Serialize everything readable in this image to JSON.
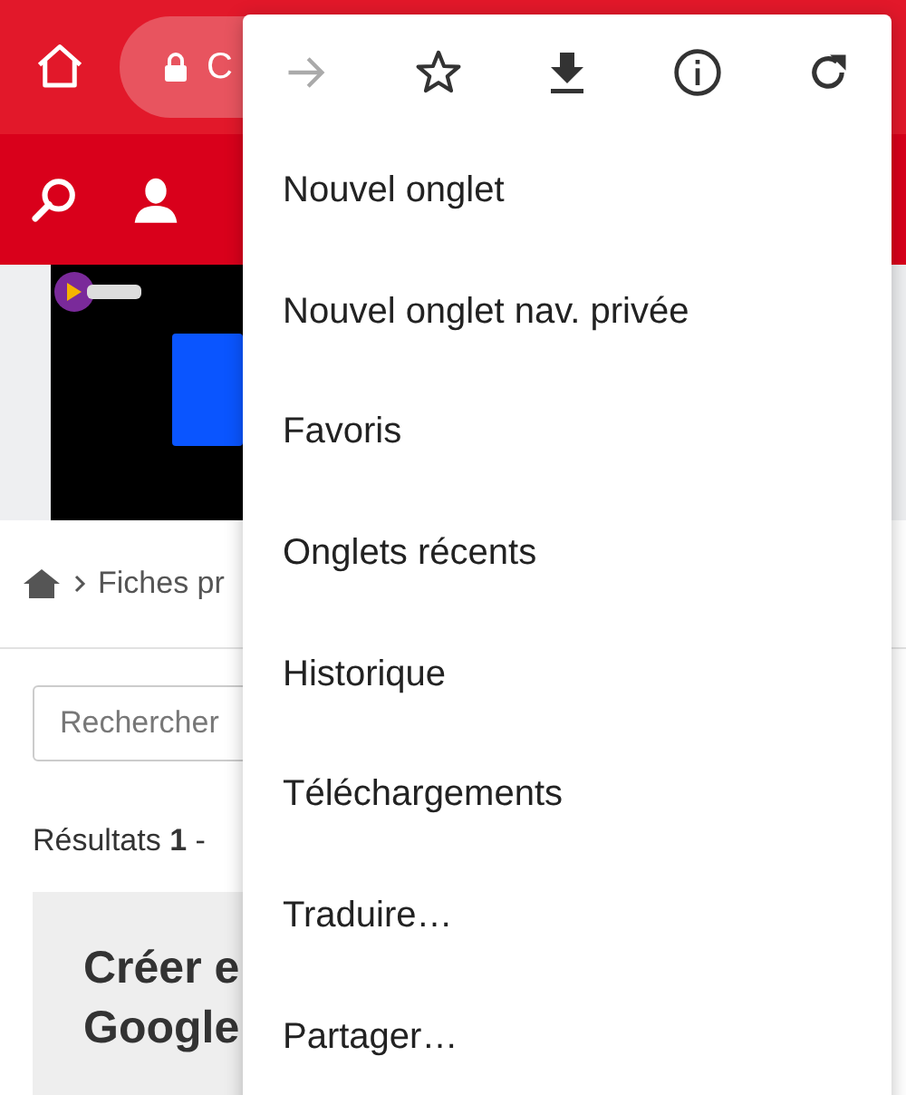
{
  "address_bar": {
    "url_text": "C"
  },
  "breadcrumb": {
    "text": "Fiches pr"
  },
  "search": {
    "placeholder": "Rechercher"
  },
  "results": {
    "text": "Résultats **1** -"
  },
  "card": {
    "title": "Créer e\nGoogle"
  },
  "menu": {
    "icons": [
      {
        "kind": "forward",
        "disabled": true
      },
      {
        "kind": "star",
        "disabled": false
      },
      {
        "kind": "download",
        "disabled": false
      },
      {
        "kind": "info",
        "disabled": false
      },
      {
        "kind": "refresh",
        "disabled": false
      }
    ],
    "items": [
      "Nouvel onglet",
      "Nouvel onglet nav. privée",
      "Favoris",
      "Onglets récents",
      "Historique",
      "Téléchargements",
      "Traduire…",
      "Partager…"
    ]
  }
}
